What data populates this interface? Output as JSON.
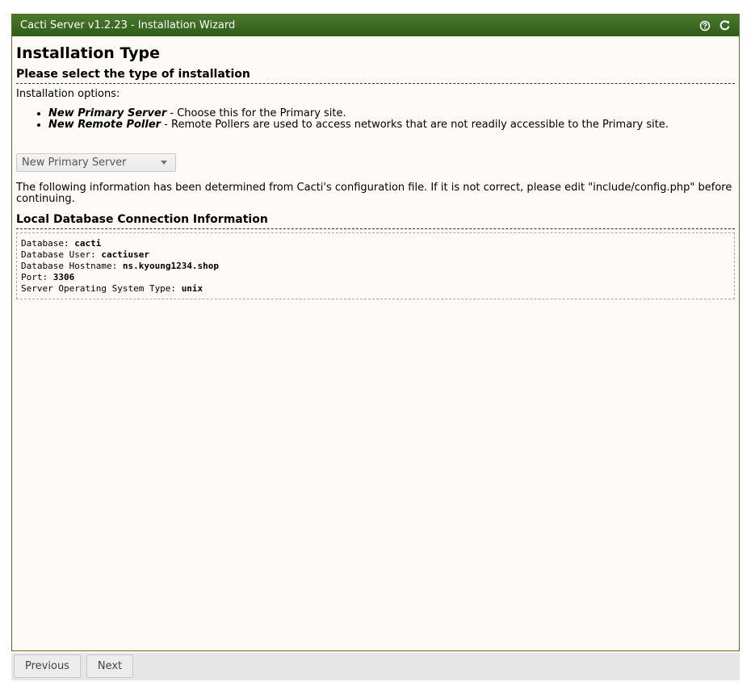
{
  "window": {
    "title": "Cacti Server v1.2.23 - Installation Wizard",
    "icons": [
      "help-icon",
      "refresh-icon"
    ],
    "accent_color": "#2f5c18"
  },
  "main": {
    "heading": "Installation Type",
    "subheading": "Please select the type of installation",
    "options_intro": "Installation options:",
    "options": [
      {
        "name": "New Primary Server",
        "desc": " - Choose this for the Primary site."
      },
      {
        "name": "New Remote Poller",
        "desc": " - Remote Pollers are used to access networks that are not readily accessible to the Primary site."
      }
    ],
    "install_type_select": {
      "value": "New Primary Server"
    },
    "info_text": "The following information has been determined from Cacti's configuration file. If it is not correct, please edit \"include/config.php\" before continuing.",
    "db_heading": "Local Database Connection Information",
    "db": [
      {
        "label": "Database: ",
        "value": "cacti"
      },
      {
        "label": "Database User: ",
        "value": "cactiuser"
      },
      {
        "label": "Database Hostname: ",
        "value": "ns.kyoung1234.shop"
      },
      {
        "label": "Port: ",
        "value": "3306"
      },
      {
        "label": "Server Operating System Type: ",
        "value": "unix"
      }
    ]
  },
  "footer": {
    "previous_label": "Previous",
    "next_label": "Next"
  }
}
